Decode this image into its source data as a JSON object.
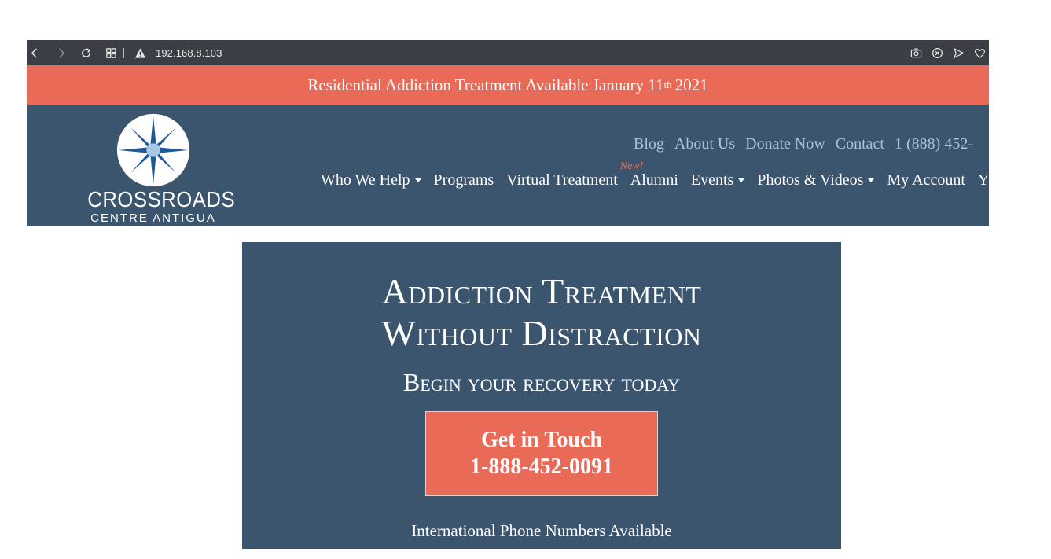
{
  "browser": {
    "url": "192.168.8.103",
    "icons": [
      "back-icon",
      "forward-icon",
      "reload-icon",
      "tabs-grid-icon",
      "warning-icon",
      "camera-icon",
      "close-circle-icon",
      "send-icon",
      "heart-icon"
    ]
  },
  "announcement": {
    "text_before": "Residential Addiction Treatment Available January 11",
    "sup": "th",
    "text_after": "2021",
    "color": "#ea6a58"
  },
  "header": {
    "logo": {
      "name": "CROSSROADS",
      "sub": "CENTRE ANTIGUA"
    },
    "top_nav": [
      "Blog",
      "About Us",
      "Donate Now",
      "Contact",
      "1 (888) 452-"
    ],
    "main_nav": [
      {
        "label": "Who We Help",
        "dropdown": true
      },
      {
        "label": "Programs",
        "dropdown": false
      },
      {
        "label": "Virtual Treatment",
        "dropdown": false
      },
      {
        "label": "Alumni",
        "dropdown": false,
        "badge": "New!"
      },
      {
        "label": "Events",
        "dropdown": true
      },
      {
        "label": "Photos & Videos",
        "dropdown": true
      },
      {
        "label": "My Account",
        "dropdown": false
      },
      {
        "label": "Y",
        "dropdown": false
      }
    ],
    "background": "#3c556e"
  },
  "hero": {
    "title_line1": "Addiction Treatment",
    "title_line2": "Without Distraction",
    "subtitle": "Begin your recovery today",
    "cta_line1": "Get in Touch",
    "cta_line2": "1-888-452-0091",
    "note": "International Phone Numbers Available"
  }
}
